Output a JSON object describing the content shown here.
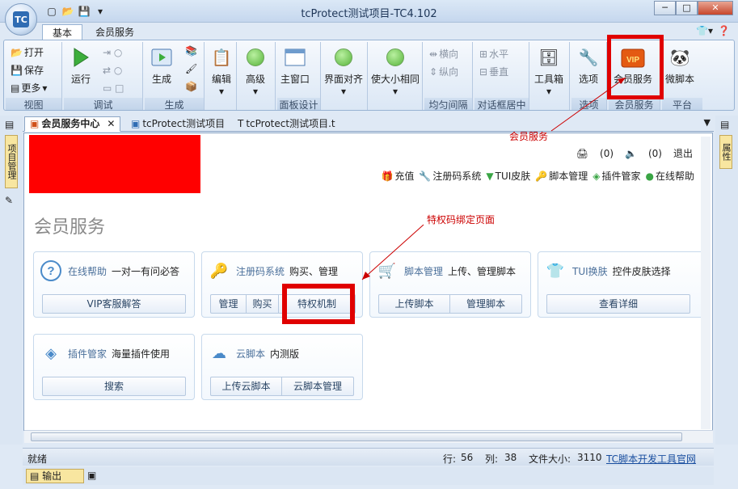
{
  "window": {
    "title": "tcProtect测试项目-TC4.102",
    "app_logo": "TC"
  },
  "ribbon_tabs": [
    "基本",
    "会员服务"
  ],
  "ribbon_groups": {
    "view": {
      "label": "视图",
      "open": "打开",
      "save": "保存",
      "more": "更多"
    },
    "debug": {
      "label": "调试",
      "run": "运行"
    },
    "gen": {
      "label": "生成",
      "gen": "生成"
    },
    "edit": {
      "edit": "编辑"
    },
    "adv": {
      "adv": "高级"
    },
    "panel": {
      "label": "面板设计",
      "main": "主窗口"
    },
    "align": {
      "align": "界面对齐",
      "size": "使大小相同"
    },
    "spacing": {
      "label": "均匀间隔",
      "h": "横向",
      "v": "纵向"
    },
    "dialog": {
      "label": "对话框居中",
      "h": "水平",
      "v": "垂直"
    },
    "toolbox": {
      "toolbox": "工具箱"
    },
    "options": {
      "label": "选项",
      "btn": "选项"
    },
    "vip": {
      "label": "会员服务",
      "btn": "会员服务"
    },
    "platform": {
      "label": "平台",
      "btn": "微脚本"
    }
  },
  "doc_tabs": [
    "会员服务中心",
    "tcProtect测试项目",
    "tcProtect测试项目.t"
  ],
  "left_panel": "项目管理",
  "right_panel": "属性",
  "content": {
    "msg_count": "(0)",
    "sound_count": "(0)",
    "logout": "退出",
    "links": [
      "充值",
      "注册码系统",
      "TUI皮肤",
      "脚本管理",
      "插件管家",
      "在线帮助"
    ],
    "page_title": "会员服务",
    "cards": [
      {
        "name": "在线帮助",
        "desc": "一对一有问必答",
        "buttons": [
          "VIP客服解答"
        ]
      },
      {
        "name": "注册码系统",
        "desc": "购买、管理",
        "buttons": [
          "管理",
          "购买",
          "特权机制"
        ]
      },
      {
        "name": "脚本管理",
        "desc": "上传、管理脚本",
        "buttons": [
          "上传脚本",
          "管理脚本"
        ]
      },
      {
        "name": "TUI换肤",
        "desc": "控件皮肤选择",
        "buttons": [
          "查看详细"
        ]
      },
      {
        "name": "插件管家",
        "desc": "海量插件使用",
        "buttons": [
          "搜索"
        ]
      },
      {
        "name": "云脚本",
        "desc": "内测版",
        "buttons": [
          "上传云脚本",
          "云脚本管理"
        ]
      }
    ]
  },
  "annotations": {
    "vip": "会员服务",
    "priv": "特权码绑定页面"
  },
  "status": {
    "ready": "就绪",
    "line_label": "行:",
    "line": "56",
    "col_label": "列:",
    "col": "38",
    "size_label": "文件大小:",
    "size": "3110",
    "link": "TC脚本开发工具官网"
  },
  "output_tab": "输出"
}
